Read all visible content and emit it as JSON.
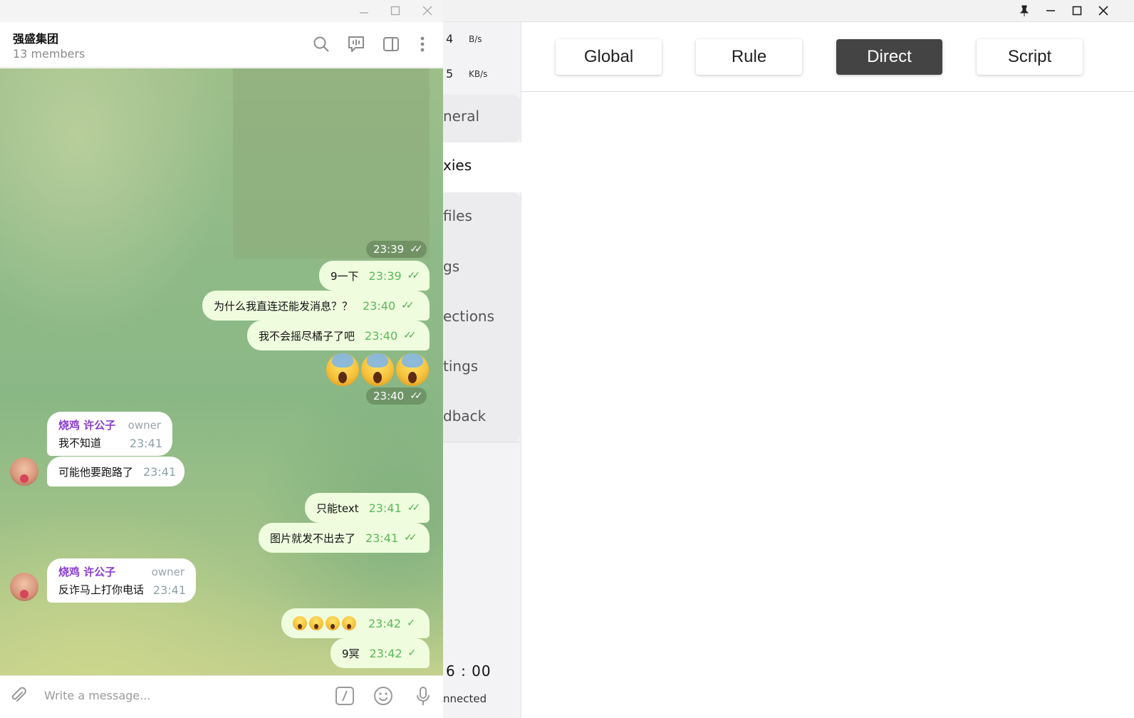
{
  "clash": {
    "titlebar_icons": [
      "pin-icon",
      "minimize-icon",
      "maximize-icon",
      "close-icon"
    ],
    "speeds": [
      {
        "value": "4",
        "unit": "B/s"
      },
      {
        "value": "5",
        "unit": "KB/s"
      }
    ],
    "nav": [
      "neral",
      "xies",
      "files",
      "gs",
      "ections",
      "tings",
      "dback"
    ],
    "active_nav": "xies",
    "clock": "6 : 00",
    "status": "nnected",
    "modes": [
      "Global",
      "Rule",
      "Direct",
      "Script"
    ],
    "active_mode": "Direct"
  },
  "telegram": {
    "chat_name": "强盛集团",
    "members": "13 members",
    "photo_time": "23:39",
    "outgoing": [
      {
        "text": "9一下",
        "time": "23:39"
      },
      {
        "text": "为什么我直连还能发消息？？",
        "time": "23:40"
      },
      {
        "text": "我不会摇尽橘子了吧",
        "time": "23:40"
      },
      {
        "text": "只能text",
        "time": "23:41"
      },
      {
        "text": "图片就发不出去了",
        "time": "23:41"
      },
      {
        "text": "😱😱😱😱",
        "time": "23:42"
      },
      {
        "text": "9冥",
        "time": "23:42"
      }
    ],
    "emoji_time": "23:40",
    "incoming": [
      {
        "sender": "烧鸡 许公子",
        "role": "owner",
        "text": "我不知道",
        "time": "23:41"
      },
      {
        "text": "可能他要跑路了",
        "time": "23:41"
      },
      {
        "sender": "烧鸡 许公子",
        "role": "owner",
        "text": "反诈马上打你电话",
        "time": "23:41"
      }
    ],
    "compose_placeholder": "Write a message..."
  }
}
